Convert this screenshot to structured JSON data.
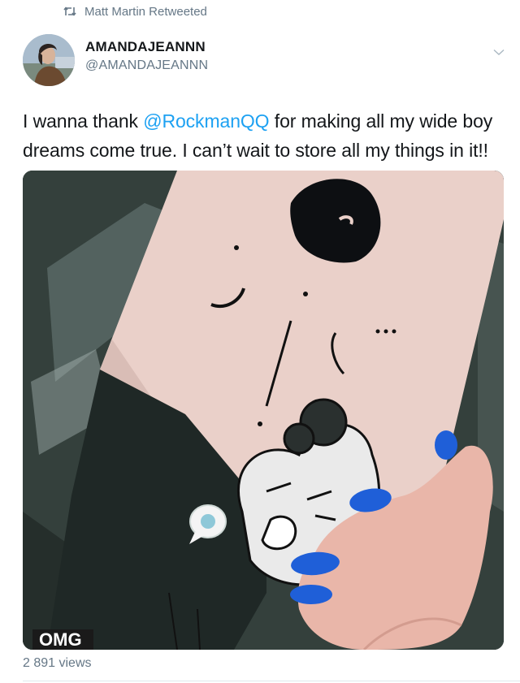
{
  "retweet": {
    "icon": "retweet-icon",
    "text": "Matt Martin Retweeted"
  },
  "author": {
    "name": "AMANDAJEANNN",
    "handle": "@AMANDAJEANNN"
  },
  "tweet": {
    "text_before": "I wanna thank ",
    "mention": "@RockmanQQ",
    "text_after": " for making all my wide boy dreams come true. I can’t wait to store all my things in it!!"
  },
  "video": {
    "caption": "OMG",
    "views": "2 891 views"
  },
  "colors": {
    "accent": "#1da1f2",
    "secondary_text": "#657786",
    "nail_polish": "#1f5fd8"
  }
}
